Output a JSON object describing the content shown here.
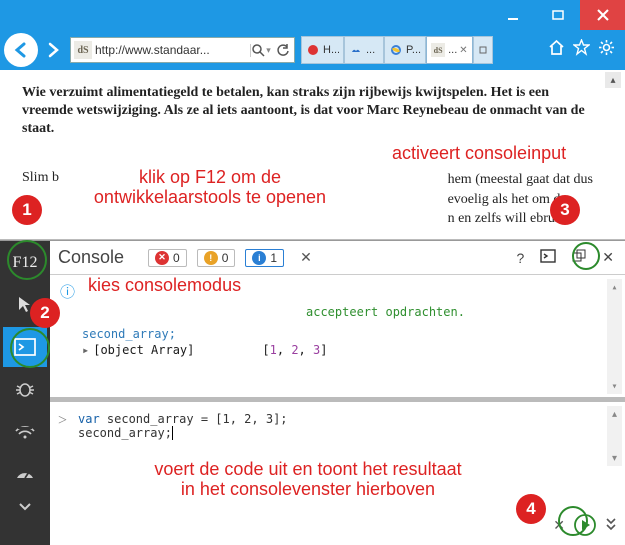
{
  "titlebar": {
    "minimize_icon": "minimize",
    "maximize_icon": "maximize",
    "close_icon": "close"
  },
  "navbar": {
    "favicon_text": "dS",
    "url": "http://www.standaar...",
    "search_placeholder": "",
    "tabs": [
      {
        "icon": "red-dot",
        "label": "H..."
      },
      {
        "icon": "onedrive",
        "label": "..."
      },
      {
        "icon": "ie",
        "label": "P..."
      },
      {
        "icon": "ds",
        "label": "..."
      }
    ]
  },
  "page": {
    "lead": "Wie verzuimt alimentatiegeld te betalen, kan straks zijn rijbewijs kwijtspelen. Het is een vreemde wetswijziging. Als ze al iets aantoont, is dat voor Marc Reynebeau de onmacht van de staat.",
    "frag_left": "Slim b",
    "frag_right_1": "hem (meestal gaat dat dus",
    "frag_right_2": "evoelig als het om de",
    "frag_right_3": "n en zelfs will      ebruik"
  },
  "annotations": {
    "a1_line1": "klik op F12 om de",
    "a1_line2": "ontwikkelaarstools te openen",
    "a2": "kies consolemodus",
    "a3": "activeert consoleinput",
    "a4_line1": "voert de code uit en toont het resultaat",
    "a4_line2": "in het consolevenster hierboven"
  },
  "badges": {
    "b1": "1",
    "b2": "2",
    "b3": "3",
    "b4": "4"
  },
  "devtools": {
    "title": "Console",
    "errors": "0",
    "warnings": "0",
    "info": "1",
    "accepts": "accepteert opdrachten.",
    "sec_array_ref": "second_array;",
    "object_array": "[object Array]",
    "array_values": "[1, 2, 3]",
    "input_line1_kw": "var",
    "input_line1_rest": " second_array = [1, 2, 3];",
    "input_line2": "second_array;",
    "help_label": "?"
  }
}
